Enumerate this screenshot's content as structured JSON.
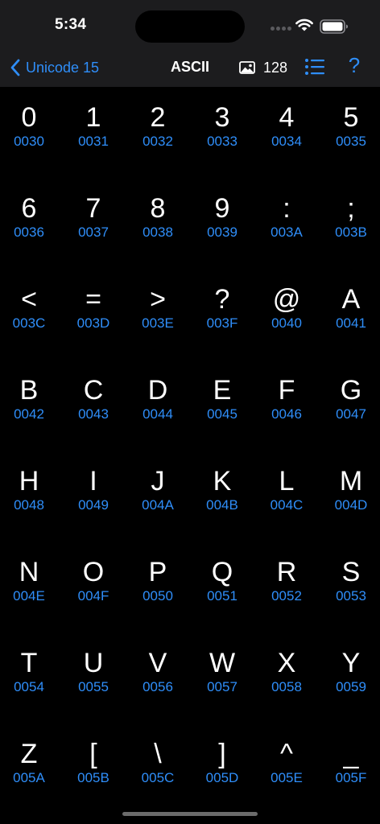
{
  "status_bar": {
    "time": "5:34"
  },
  "nav": {
    "back_label": "Unicode 15",
    "title": "ASCII",
    "image_count": "128",
    "help_label": "?"
  },
  "colors": {
    "accent": "#2f8ef9",
    "background": "#000000",
    "bar_background": "#1c1c1e"
  },
  "icons": {
    "back": "chevron-left-icon",
    "image": "photo-icon",
    "list": "list-icon",
    "wifi": "wifi-icon",
    "battery": "battery-icon"
  },
  "characters": [
    {
      "glyph": "0",
      "code": "0030"
    },
    {
      "glyph": "1",
      "code": "0031"
    },
    {
      "glyph": "2",
      "code": "0032"
    },
    {
      "glyph": "3",
      "code": "0033"
    },
    {
      "glyph": "4",
      "code": "0034"
    },
    {
      "glyph": "5",
      "code": "0035"
    },
    {
      "glyph": "6",
      "code": "0036"
    },
    {
      "glyph": "7",
      "code": "0037"
    },
    {
      "glyph": "8",
      "code": "0038"
    },
    {
      "glyph": "9",
      "code": "0039"
    },
    {
      "glyph": ":",
      "code": "003A"
    },
    {
      "glyph": ";",
      "code": "003B"
    },
    {
      "glyph": "<",
      "code": "003C"
    },
    {
      "glyph": "=",
      "code": "003D"
    },
    {
      "glyph": ">",
      "code": "003E"
    },
    {
      "glyph": "?",
      "code": "003F"
    },
    {
      "glyph": "@",
      "code": "0040"
    },
    {
      "glyph": "A",
      "code": "0041"
    },
    {
      "glyph": "B",
      "code": "0042"
    },
    {
      "glyph": "C",
      "code": "0043"
    },
    {
      "glyph": "D",
      "code": "0044"
    },
    {
      "glyph": "E",
      "code": "0045"
    },
    {
      "glyph": "F",
      "code": "0046"
    },
    {
      "glyph": "G",
      "code": "0047"
    },
    {
      "glyph": "H",
      "code": "0048"
    },
    {
      "glyph": "I",
      "code": "0049"
    },
    {
      "glyph": "J",
      "code": "004A"
    },
    {
      "glyph": "K",
      "code": "004B"
    },
    {
      "glyph": "L",
      "code": "004C"
    },
    {
      "glyph": "M",
      "code": "004D"
    },
    {
      "glyph": "N",
      "code": "004E"
    },
    {
      "glyph": "O",
      "code": "004F"
    },
    {
      "glyph": "P",
      "code": "0050"
    },
    {
      "glyph": "Q",
      "code": "0051"
    },
    {
      "glyph": "R",
      "code": "0052"
    },
    {
      "glyph": "S",
      "code": "0053"
    },
    {
      "glyph": "T",
      "code": "0054"
    },
    {
      "glyph": "U",
      "code": "0055"
    },
    {
      "glyph": "V",
      "code": "0056"
    },
    {
      "glyph": "W",
      "code": "0057"
    },
    {
      "glyph": "X",
      "code": "0058"
    },
    {
      "glyph": "Y",
      "code": "0059"
    },
    {
      "glyph": "Z",
      "code": "005A"
    },
    {
      "glyph": "[",
      "code": "005B"
    },
    {
      "glyph": "\\",
      "code": "005C"
    },
    {
      "glyph": "]",
      "code": "005D"
    },
    {
      "glyph": "^",
      "code": "005E"
    },
    {
      "glyph": "_",
      "code": "005F"
    }
  ]
}
